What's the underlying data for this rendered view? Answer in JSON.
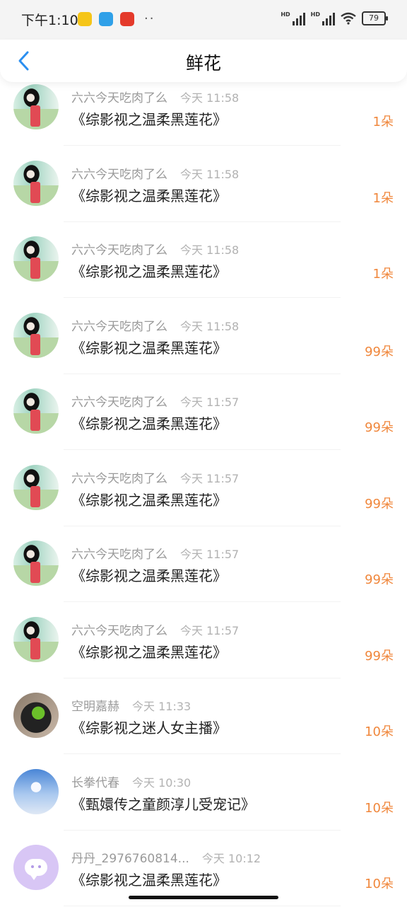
{
  "status_bar": {
    "time": "下午1:10",
    "battery": "79"
  },
  "header": {
    "title": "鲜花"
  },
  "items": [
    {
      "user": "六六今天吃肉了么",
      "time": "今天 11:58",
      "book": "《综影视之温柔黑莲花》",
      "count": "1朵",
      "avatar": "girl"
    },
    {
      "user": "六六今天吃肉了么",
      "time": "今天 11:58",
      "book": "《综影视之温柔黑莲花》",
      "count": "1朵",
      "avatar": "girl"
    },
    {
      "user": "六六今天吃肉了么",
      "time": "今天 11:58",
      "book": "《综影视之温柔黑莲花》",
      "count": "1朵",
      "avatar": "girl"
    },
    {
      "user": "六六今天吃肉了么",
      "time": "今天 11:58",
      "book": "《综影视之温柔黑莲花》",
      "count": "99朵",
      "avatar": "girl"
    },
    {
      "user": "六六今天吃肉了么",
      "time": "今天 11:57",
      "book": "《综影视之温柔黑莲花》",
      "count": "99朵",
      "avatar": "girl"
    },
    {
      "user": "六六今天吃肉了么",
      "time": "今天 11:57",
      "book": "《综影视之温柔黑莲花》",
      "count": "99朵",
      "avatar": "girl"
    },
    {
      "user": "六六今天吃肉了么",
      "time": "今天 11:57",
      "book": "《综影视之温柔黑莲花》",
      "count": "99朵",
      "avatar": "girl"
    },
    {
      "user": "六六今天吃肉了么",
      "time": "今天 11:57",
      "book": "《综影视之温柔黑莲花》",
      "count": "99朵",
      "avatar": "girl"
    },
    {
      "user": "空明嘉赫",
      "time": "今天 11:33",
      "book": "《综影视之迷人女主播》",
      "count": "10朵",
      "avatar": "dark"
    },
    {
      "user": "长拳代春",
      "time": "今天 10:30",
      "book": "《甄嬛传之童颜淳儿受宠记》",
      "count": "10朵",
      "avatar": "sky"
    },
    {
      "user": "丹丹_2976760814...",
      "time": "今天 10:12",
      "book": "《综影视之温柔黑莲花》",
      "count": "10朵",
      "avatar": "bot"
    }
  ],
  "colors": {
    "accent": "#f0873c",
    "back_icon": "#2b8ff0"
  },
  "icons": {
    "back": "chevron-left-icon",
    "wifi": "wifi-icon",
    "signal": "signal-icon",
    "battery": "battery-icon"
  }
}
